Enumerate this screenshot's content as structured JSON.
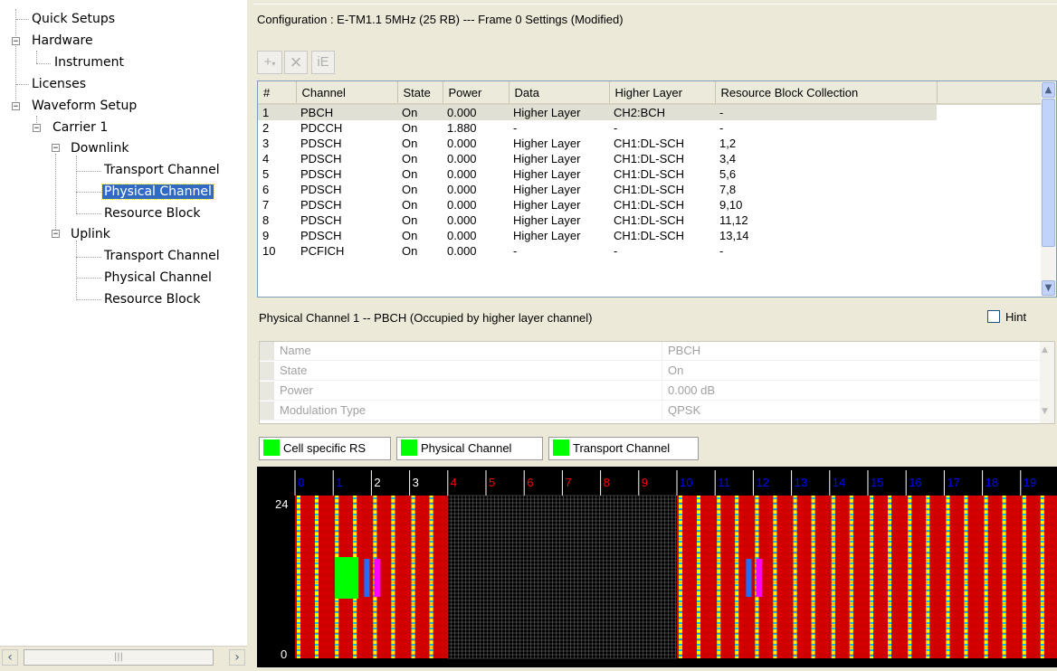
{
  "tree": {
    "items": [
      {
        "label": "Quick Setups"
      },
      {
        "label": "Hardware"
      },
      {
        "label": "Instrument"
      },
      {
        "label": "Licenses"
      },
      {
        "label": "Waveform Setup"
      },
      {
        "label": "Carrier 1"
      },
      {
        "label": "Downlink"
      },
      {
        "label": "Transport Channel"
      },
      {
        "label": "Physical Channel"
      },
      {
        "label": "Resource Block"
      },
      {
        "label": "Uplink"
      },
      {
        "label": "Transport Channel"
      },
      {
        "label": "Physical Channel"
      },
      {
        "label": "Resource Block"
      }
    ],
    "selected": "Physical Channel"
  },
  "config": {
    "title": "Configuration : E-TM1.1 5MHz (25 RB) --- Frame 0 Settings (Modified)"
  },
  "toolbar": {
    "add": "+",
    "remove": "×",
    "ie": "iE"
  },
  "channel_table": {
    "headers": [
      "#",
      "Channel",
      "State",
      "Power",
      "Data",
      "Higher Layer",
      "Resource Block Collection"
    ],
    "rows": [
      [
        "1",
        "PBCH",
        "On",
        "0.000",
        "Higher Layer",
        "CH2:BCH",
        "-"
      ],
      [
        "2",
        "PDCCH",
        "On",
        "1.880",
        "-",
        "-",
        "-"
      ],
      [
        "3",
        "PDSCH",
        "On",
        "0.000",
        "Higher Layer",
        "CH1:DL-SCH",
        "1,2"
      ],
      [
        "4",
        "PDSCH",
        "On",
        "0.000",
        "Higher Layer",
        "CH1:DL-SCH",
        "3,4"
      ],
      [
        "5",
        "PDSCH",
        "On",
        "0.000",
        "Higher Layer",
        "CH1:DL-SCH",
        "5,6"
      ],
      [
        "6",
        "PDSCH",
        "On",
        "0.000",
        "Higher Layer",
        "CH1:DL-SCH",
        "7,8"
      ],
      [
        "7",
        "PDSCH",
        "On",
        "0.000",
        "Higher Layer",
        "CH1:DL-SCH",
        "9,10"
      ],
      [
        "8",
        "PDSCH",
        "On",
        "0.000",
        "Higher Layer",
        "CH1:DL-SCH",
        "11,12"
      ],
      [
        "9",
        "PDSCH",
        "On",
        "0.000",
        "Higher Layer",
        "CH1:DL-SCH",
        "13,14"
      ],
      [
        "10",
        "PCFICH",
        "On",
        "0.000",
        "-",
        "-",
        "-"
      ]
    ]
  },
  "detail": {
    "title": "Physical Channel 1 -- PBCH (Occupied by higher layer channel)",
    "hint_label": "Hint",
    "properties": [
      {
        "name": "Name",
        "value": "PBCH"
      },
      {
        "name": "State",
        "value": "On"
      },
      {
        "name": "Power",
        "value": "0.000 dB"
      },
      {
        "name": "Modulation Type",
        "value": "QPSK"
      }
    ]
  },
  "legend": {
    "items": [
      {
        "label": "Cell specific RS",
        "color": "#00ff00"
      },
      {
        "label": "Physical Channel",
        "color": "#00ff00"
      },
      {
        "label": "Transport Channel",
        "color": "#00ff00"
      }
    ]
  },
  "rb_grid": {
    "subframes": [
      "0",
      "1",
      "2",
      "3",
      "4",
      "5",
      "6",
      "7",
      "8",
      "9",
      "10",
      "11",
      "12",
      "13",
      "14",
      "15",
      "16",
      "17",
      "18",
      "19"
    ],
    "subframe_colors": [
      "#0000ff",
      "#0000ff",
      "#000000",
      "#000000",
      "#ff0000",
      "#ff0000",
      "#ff0000",
      "#ff0000",
      "#ff0000",
      "#ff0000",
      "#0000ff",
      "#0000ff",
      "#0000ff",
      "#0000ff",
      "#0000ff",
      "#0000ff",
      "#0000ff",
      "#0000ff",
      "#0000ff",
      "#0000ff"
    ],
    "y_top_label": "24",
    "y_bottom_label": "0",
    "colors": {
      "background": "#000000",
      "allocated": "#d40000",
      "reference": "#ffff00",
      "pbch": "#00ff00",
      "sync_blue": "#1c6fff",
      "sync_magenta": "#ff00ff"
    }
  }
}
